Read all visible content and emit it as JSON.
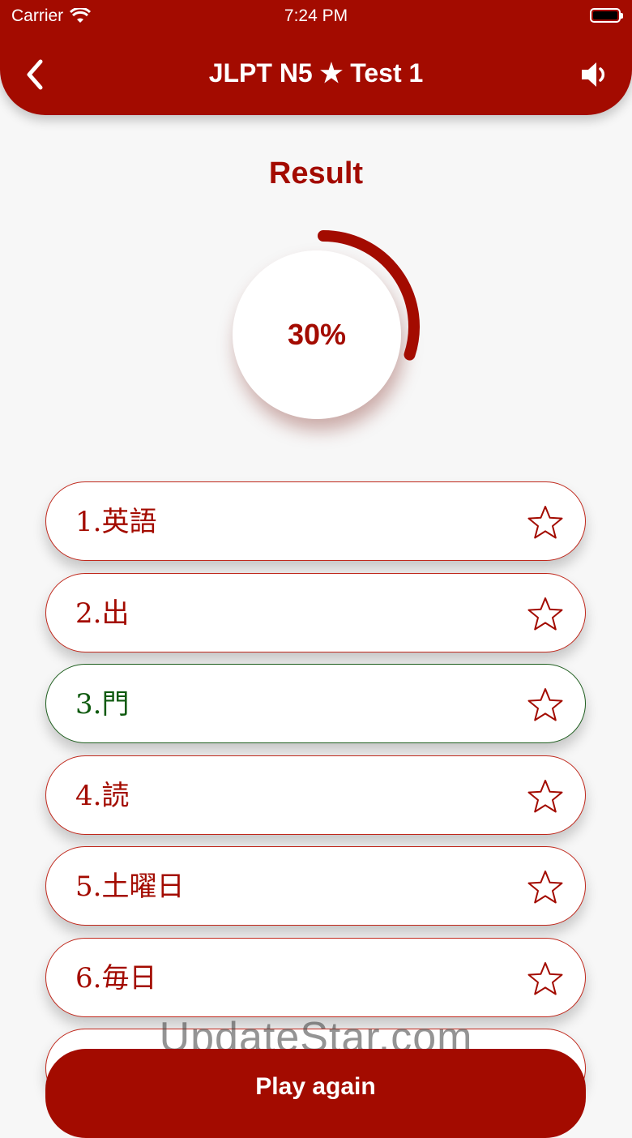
{
  "status_bar": {
    "carrier": "Carrier",
    "time": "7:24 PM"
  },
  "header": {
    "title": "JLPT N5 ★ Test 1",
    "background_color": "#a30b00",
    "back_icon": "chevron-left-icon",
    "sound_icon": "speaker-icon"
  },
  "result": {
    "title": "Result",
    "percent_text": "30%",
    "progress_fraction": 0.3,
    "accent_color": "#a30b00"
  },
  "questions": [
    {
      "label": "1.英語",
      "status": "wrong"
    },
    {
      "label": "2.出",
      "status": "wrong"
    },
    {
      "label": "3.門",
      "status": "correct"
    },
    {
      "label": "4.読",
      "status": "wrong"
    },
    {
      "label": "5.土曜日",
      "status": "wrong"
    },
    {
      "label": "6.毎日",
      "status": "wrong"
    },
    {
      "label": "",
      "status": "wrong"
    }
  ],
  "colors": {
    "wrong": "#a30b00",
    "correct": "#0f5a0f"
  },
  "watermark": "UpdateStar.com",
  "play_again_label": "Play again"
}
